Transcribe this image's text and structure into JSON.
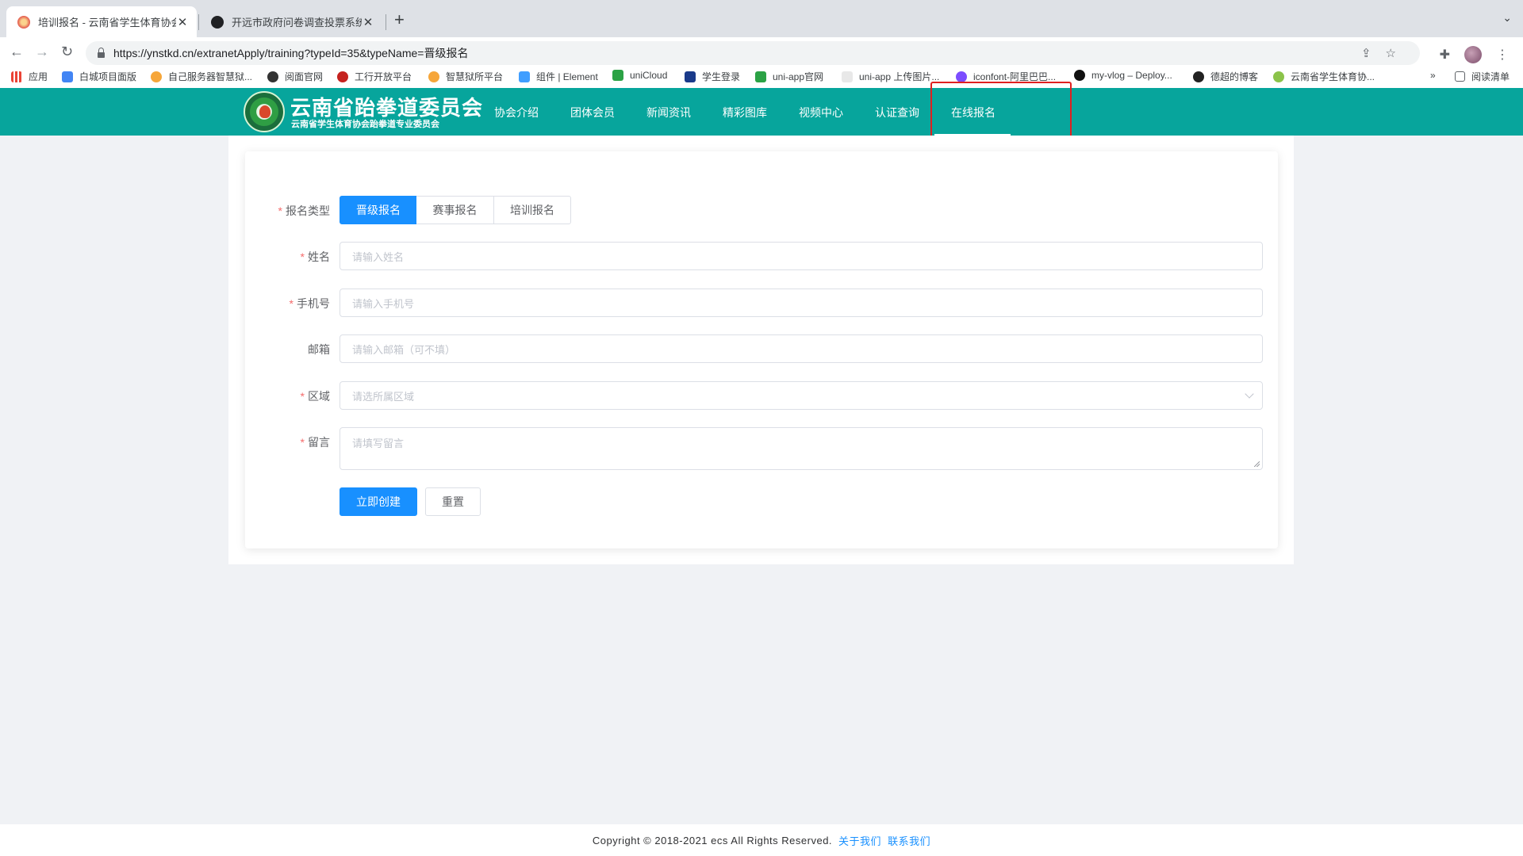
{
  "browser": {
    "tabs": [
      {
        "title": "培训报名 - 云南省学生体育协会",
        "active": true
      },
      {
        "title": "开远市政府问卷调查投票系统 | 新",
        "active": false
      }
    ],
    "url": "https://ynstkd.cn/extranetApply/training?typeId=35&typeName=晋级报名",
    "bookmarks": [
      "应用",
      "白城项目面版",
      "自己服务器智慧狱...",
      "阅面官网",
      "工行开放平台",
      "智慧狱所平台",
      "组件 | Element",
      "uniCloud",
      "学生登录",
      "uni-app官网",
      "uni-app 上传图片...",
      "iconfont-阿里巴巴...",
      "my-vlog – Deploy...",
      "德超的博客",
      "云南省学生体育协..."
    ],
    "reading_list": "阅读清单",
    "more": "»"
  },
  "site": {
    "logo_title": "云南省跆拳道委员会",
    "logo_subtitle": "云南省学生体育协会跆拳道专业委员会",
    "nav": [
      "协会介绍",
      "团体会员",
      "新闻资讯",
      "精彩图库",
      "视频中心",
      "认证查询",
      "在线报名"
    ],
    "active_nav": "在线报名",
    "colors": {
      "header": "#07a59c",
      "primary": "#1890ff",
      "required": "#f56c6c",
      "highlight": "#e02020"
    }
  },
  "form": {
    "type_label": "报名类型",
    "type_options": [
      "晋级报名",
      "赛事报名",
      "培训报名"
    ],
    "type_selected": "晋级报名",
    "name_label": "姓名",
    "name_placeholder": "请输入姓名",
    "phone_label": "手机号",
    "phone_placeholder": "请输入手机号",
    "email_label": "邮箱",
    "email_placeholder": "请输入邮箱（可不填）",
    "region_label": "区域",
    "region_placeholder": "请选所属区域",
    "message_label": "留言",
    "message_placeholder": "请填写留言",
    "submit": "立即创建",
    "reset": "重置"
  },
  "footer": {
    "copyright": "Copyright © 2018-2021 ecs All Rights Reserved.",
    "about": "关于我们",
    "contact": "联系我们"
  }
}
